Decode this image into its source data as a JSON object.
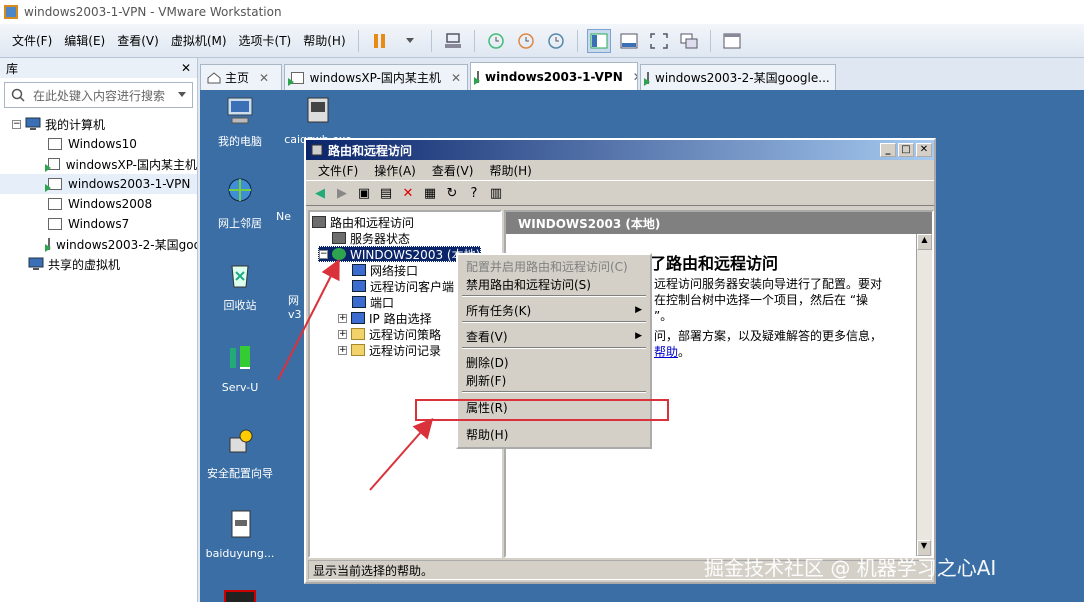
{
  "window": {
    "title": "windows2003-1-VPN - VMware Workstation"
  },
  "menubar": {
    "items": [
      "文件(F)",
      "编辑(E)",
      "查看(V)",
      "虚拟机(M)",
      "选项卡(T)",
      "帮助(H)"
    ]
  },
  "library": {
    "title": "库",
    "close": "✕",
    "search_placeholder": "在此处键入内容进行搜索",
    "root": "我的计算机",
    "vms": [
      {
        "name": "Windows10",
        "running": false
      },
      {
        "name": "windowsXP-国内某主机",
        "running": true
      },
      {
        "name": "windows2003-1-VPN",
        "running": true,
        "selected": true
      },
      {
        "name": "Windows2008",
        "running": false
      },
      {
        "name": "Windows7",
        "running": false
      },
      {
        "name": "windows2003-2-某国google",
        "running": true
      }
    ],
    "shared": "共享的虚拟机"
  },
  "tabs": [
    {
      "label": "主页",
      "active": false
    },
    {
      "label": "windowsXP-国内某主机",
      "active": false
    },
    {
      "label": "windows2003-1-VPN",
      "active": true
    },
    {
      "label": "windows2003-2-某国google...",
      "active": false
    }
  ],
  "desktop_icons": [
    {
      "label": "我的电脑"
    },
    {
      "label": "caiqzwb.exe"
    },
    {
      "label": "网上邻居"
    },
    {
      "label": "Ne"
    },
    {
      "label": "回收站"
    },
    {
      "label": "网"
    },
    {
      "label": "v3"
    },
    {
      "label": "Serv-U"
    },
    {
      "label": "安全配置向导"
    },
    {
      "label": "baiduyung..."
    }
  ],
  "rras": {
    "title": "路由和远程访问",
    "menu": [
      "文件(F)",
      "操作(A)",
      "查看(V)",
      "帮助(H)"
    ],
    "tree": {
      "root": "路由和远程访问",
      "server_status": "服务器状态",
      "server": "WINDOWS2003 (本地)",
      "children": [
        "网络接口",
        "远程访问客户端",
        "端口",
        "IP 路由选择",
        "远程访问策略",
        "远程访问记录"
      ]
    },
    "right_header": "WINDOWS2003 (本地)",
    "heading": "了路由和远程访问",
    "para1_l1": "远程访问服务器安装向导进行了配置。要对",
    "para1_l2": "在控制台树中选择一个项目，然后在 “操",
    "para1_l3": "”。",
    "para2_l1": "问，部署方案，以及疑难解答的更多信息，",
    "para2_link": "帮助",
    "para2_end": "。",
    "status": "显示当前选择的帮助。"
  },
  "context_menu": {
    "items": [
      {
        "label": "配置并启用路由和远程访问(C)",
        "disabled": true
      },
      {
        "label": "禁用路由和远程访问(S)",
        "disabled": false
      },
      {
        "label": "所有任务(K)",
        "submenu": true
      },
      {
        "label": "查看(V)",
        "submenu": true
      },
      {
        "label": "删除(D)",
        "disabled": false
      },
      {
        "label": "刷新(F)",
        "disabled": false
      },
      {
        "label": "属性(R)",
        "disabled": false,
        "highlighted": true
      },
      {
        "label": "帮助(H)",
        "disabled": false
      }
    ]
  },
  "watermark": "掘金技术社区 @ 机器学习之心AI",
  "colors": {
    "desktop": "#3a6ea5",
    "titlebar": "#0a246a",
    "annotation": "#d9323a"
  }
}
